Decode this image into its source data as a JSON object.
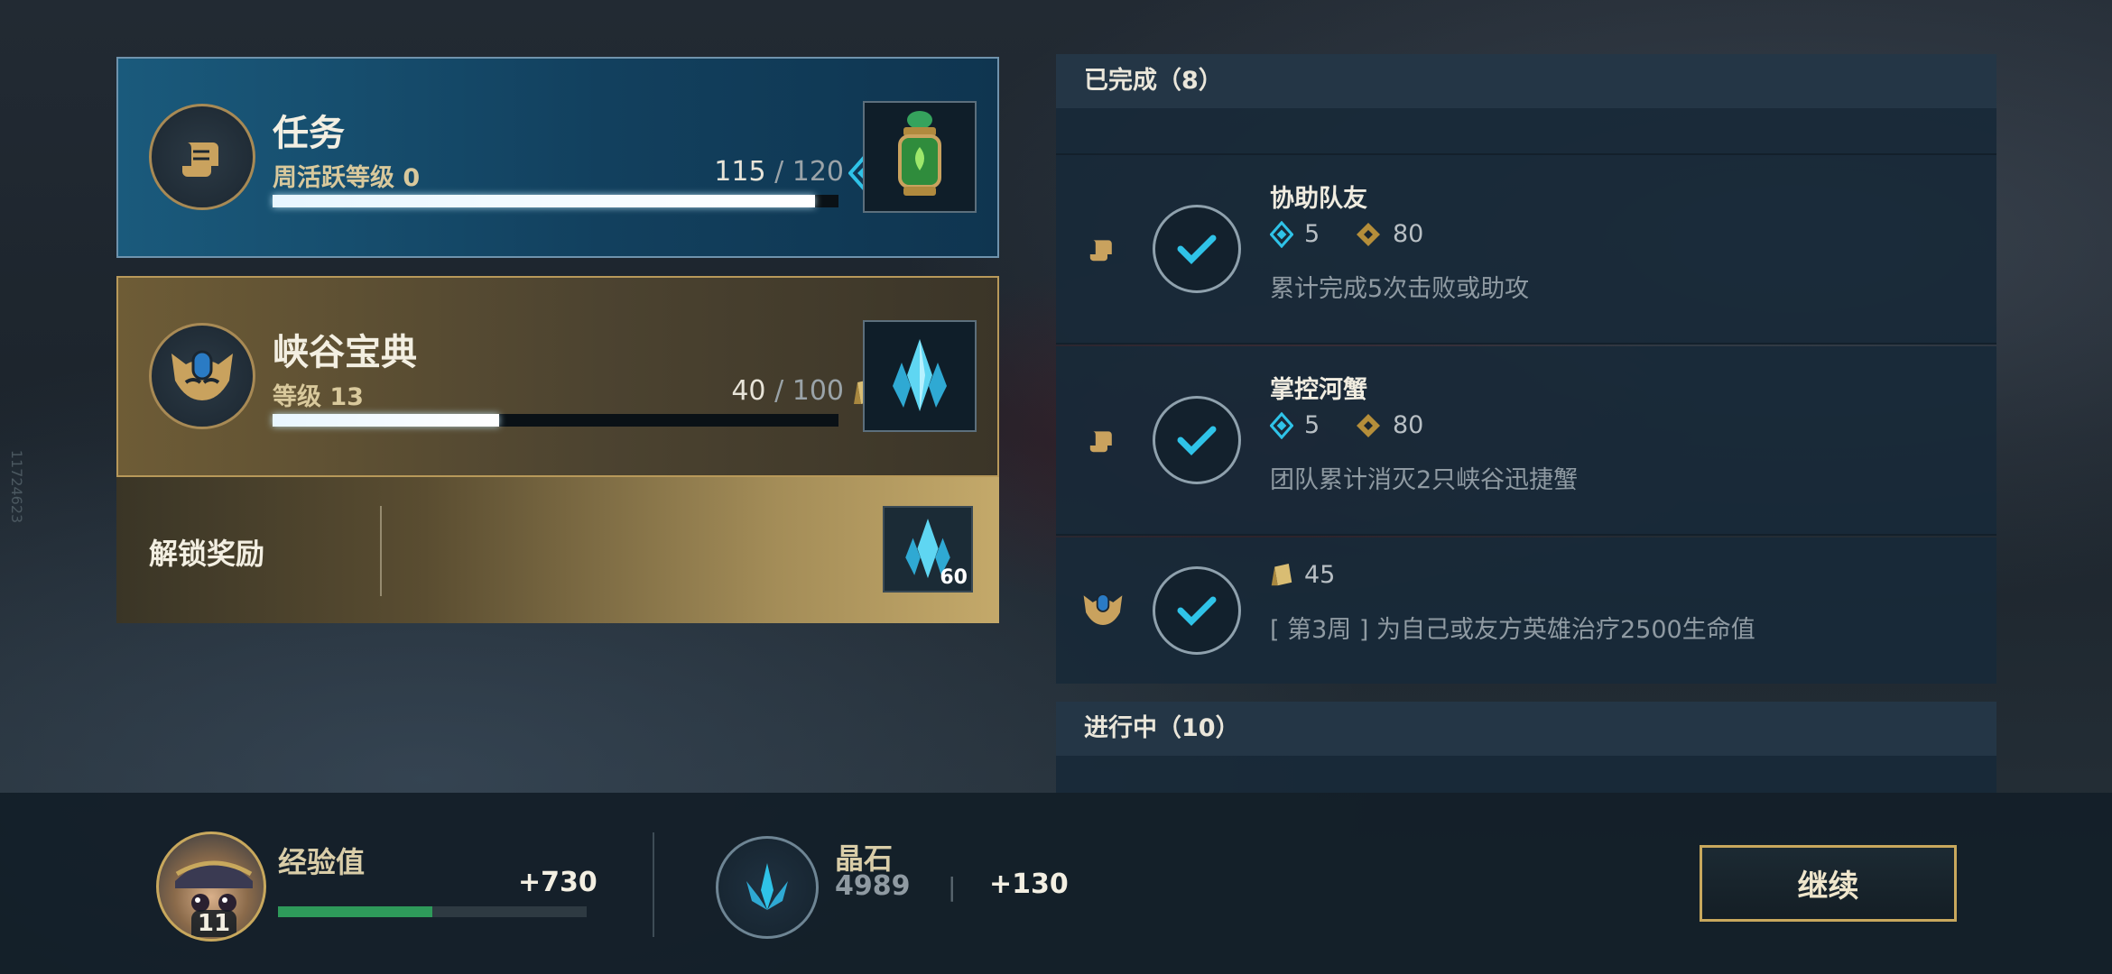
{
  "side_watermark": "11724623",
  "quest_card": {
    "title": "任务",
    "subtitle": "周活跃等级 0",
    "progress_current": "115",
    "progress_sep": "/",
    "progress_total": "120",
    "progress_fraction": 0.958
  },
  "pass_card": {
    "title": "峡谷宝典",
    "subtitle": "等级 13",
    "progress_current": "40",
    "progress_sep": "/",
    "progress_total": "100",
    "progress_fraction": 0.4
  },
  "unlock": {
    "label": "解锁奖励",
    "reward_count": "60"
  },
  "completed": {
    "header": "已完成（8）",
    "tasks": [
      {
        "title": "协助队友",
        "activity_points": "5",
        "currency": "80",
        "desc": "累计完成5次击败或助攻"
      },
      {
        "title": "掌控河蟹",
        "activity_points": "5",
        "currency": "80",
        "desc": "团队累计消灭2只峡谷迅捷蟹"
      },
      {
        "pass_points": "45",
        "desc": "[ 第3周 ] 为自己或友方英雄治疗2500生命值"
      }
    ]
  },
  "in_progress": {
    "header": "进行中（10）"
  },
  "bottom": {
    "level": "11",
    "xp_label": "经验值",
    "xp_gain": "+730",
    "xp_fraction": 0.5,
    "crystal_label": "晶石",
    "crystal_total": "4989",
    "crystal_sep": "|",
    "crystal_gain": "+130",
    "continue_label": "继续"
  },
  "colors": {
    "accent_cyan": "#2fc3e8",
    "gold": "#c8a85d",
    "xp_green": "#2e9a5a"
  }
}
